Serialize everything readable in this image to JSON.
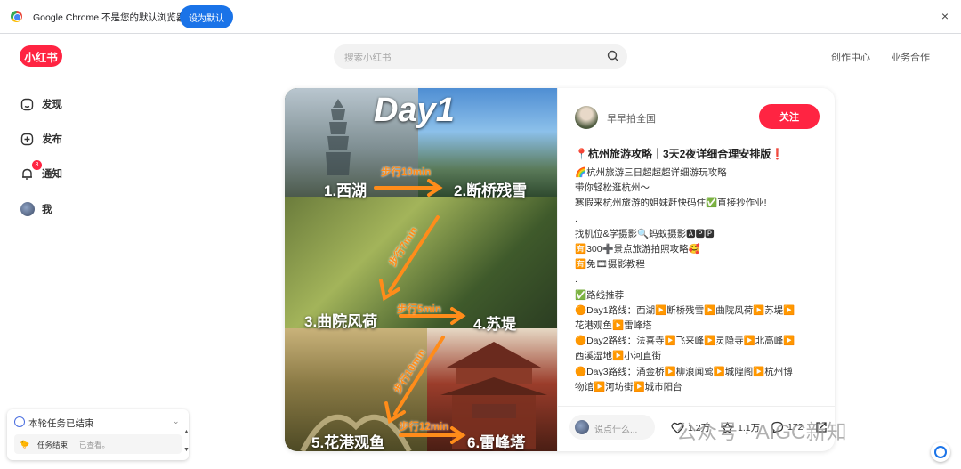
{
  "browser_banner": {
    "message": "Google Chrome 不是您的默认浏览器",
    "set_default_label": "设为默认",
    "close_label": "×"
  },
  "header": {
    "logo_text": "小红书",
    "search_placeholder": "搜索小红书",
    "nav": [
      "创作中心",
      "业务合作"
    ]
  },
  "sidebar": {
    "items": [
      {
        "label": "发现",
        "icon": "home-icon"
      },
      {
        "label": "发布",
        "icon": "plus-square-icon"
      },
      {
        "label": "通知",
        "icon": "bell-icon",
        "badge": "3"
      },
      {
        "label": "我",
        "icon": "avatar-icon"
      }
    ]
  },
  "task_panel": {
    "title": "本轮任务已结束",
    "row_status": "任务结束",
    "row_detail": "已查看。"
  },
  "note": {
    "photo": {
      "day_label": "Day1",
      "spots": [
        "1.西湖",
        "2.断桥残雪",
        "3.曲院风荷",
        "4.苏堤",
        "5.花港观鱼",
        "6.雷峰塔"
      ],
      "walk_labels": [
        "步行10min",
        "步行7min",
        "步行5min",
        "步行10min",
        "步行12min"
      ]
    },
    "author": "早早拍全国",
    "follow_label": "关注",
    "title": "📍杭州旅游攻略｜3天2夜详细合理安排版❗",
    "body_lines": [
      "🌈杭州旅游三日超超超详细游玩攻略",
      "带你轻松逛杭州～",
      "寒假来杭州旅游的姐妹赶快码住✅直接抄作业!",
      ".",
      "找机位&学摄影🔍蚂蚁摄影🅰🅿🅿",
      "🈶300➕景点旅游拍照攻略🥰",
      "🈶免🎞摄影教程",
      ".",
      "✅路线推荐",
      "🟠Day1路线：西湖▶️断桥残雪▶️曲院风荷▶️苏堤▶️",
      "花港观鱼▶️雷峰塔",
      "🟠Day2路线：法喜寺▶️飞来峰▶️灵隐寺▶️北高峰▶️",
      "西溪湿地▶️小河直街",
      "🟠Day3路线：涌金桥▶️柳浪闻莺▶️城隍阁▶️杭州博",
      "物馆▶️河坊街▶️城市阳台"
    ],
    "comment_placeholder": "说点什么...",
    "likes": "1.2万",
    "stars": "1.1万",
    "comments": "172"
  },
  "watermark": "公众号 · AIGC新知",
  "colors": {
    "brand": "#ff2442",
    "chrome_blue": "#1a73e8",
    "walk_orange": "#ff8c1a"
  }
}
